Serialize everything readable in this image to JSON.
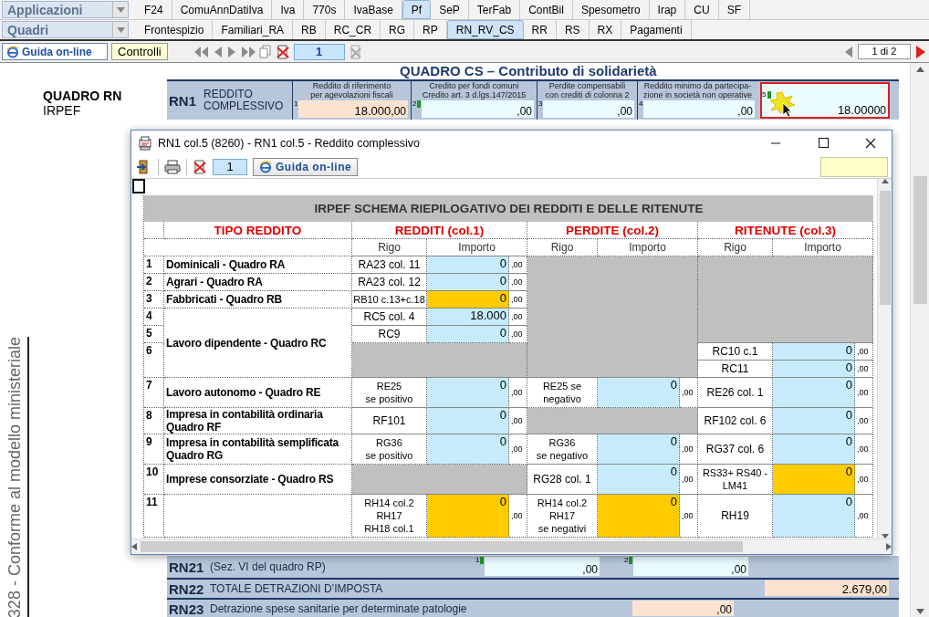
{
  "applicazioni": {
    "selector": "Applicazioni",
    "tabs": [
      {
        "label": "F24",
        "selected": false
      },
      {
        "label": "ComuAnnDatiIva",
        "selected": false
      },
      {
        "label": "Iva",
        "selected": false
      },
      {
        "label": "770s",
        "selected": false
      },
      {
        "label": "IvaBase",
        "selected": false
      },
      {
        "label": "Pf",
        "selected": true
      },
      {
        "label": "SeP",
        "selected": false
      },
      {
        "label": "TerFab",
        "selected": false
      },
      {
        "label": "ContBil",
        "selected": false
      },
      {
        "label": "Spesometro",
        "selected": false
      },
      {
        "label": "Irap",
        "selected": false
      },
      {
        "label": "CU",
        "selected": false
      },
      {
        "label": "SF",
        "selected": false
      }
    ]
  },
  "quadri": {
    "selector": "Quadri",
    "tabs": [
      {
        "label": "Frontespizio",
        "selected": false
      },
      {
        "label": "Familiari_RA",
        "selected": false
      },
      {
        "label": "RB",
        "selected": false
      },
      {
        "label": "RC_CR",
        "selected": false
      },
      {
        "label": "RG",
        "selected": false
      },
      {
        "label": "RP",
        "selected": false
      },
      {
        "label": "RN_RV_CS",
        "selected": true
      },
      {
        "label": "RR",
        "selected": false
      },
      {
        "label": "RS",
        "selected": false
      },
      {
        "label": "RX",
        "selected": false
      },
      {
        "label": "Pagamenti",
        "selected": false
      }
    ]
  },
  "toolbar": {
    "help_button": "Guida on-line",
    "controls_button": "Controlli",
    "page": "1",
    "page_indicator": "1 di 2"
  },
  "sidebar": {
    "title": "QUADRO RN",
    "subtitle": "IRPEF",
    "side_note": "328 - Conforme al modello ministeriale"
  },
  "form": {
    "header": "QUADRO CS – Contributo di solidarietà",
    "rn1": {
      "code": "RN1",
      "label": "REDDITO\nCOMPLESSIVO",
      "fields": [
        {
          "num": "1",
          "caption": "Reddito di riferimento\nper agevolazioni fiscali",
          "value": "18.000",
          "cents": ",00",
          "kind": "computed",
          "marked": false,
          "selected": false
        },
        {
          "num": "2",
          "caption": "Credito per fondi comuni\nCredito art. 3 d.lgs.147/2015",
          "cents": ",00",
          "kind": "input",
          "marked": true,
          "selected": false
        },
        {
          "num": "3",
          "caption": "Perdite compensabili\ncon crediti di colonna 2",
          "cents": ",00",
          "kind": "input",
          "marked": false,
          "selected": false
        },
        {
          "num": "4",
          "caption": "Reddito minimo da partecipa-\nzione in società non operative",
          "cents": ",00",
          "kind": "input",
          "marked": false,
          "selected": false
        },
        {
          "num": "5",
          "value": "18.000",
          "cents": "00",
          "kind": "input",
          "marked": true,
          "selected": true
        }
      ]
    },
    "rows": [
      {
        "code": "RN21",
        "label": "(Sez. VI del quadro RP)",
        "fields": [
          {
            "num": "1",
            "cents": ",00",
            "kind": "input",
            "marked": true
          },
          {
            "num": "2",
            "cents": ",00",
            "kind": "input",
            "marked": true
          }
        ]
      },
      {
        "code": "RN22",
        "label": "TOTALE DETRAZIONI D’IMPOSTA",
        "fields": [
          {
            "value": "2.679",
            "cents": ",00",
            "kind": "computed",
            "marked": false
          }
        ]
      },
      {
        "code": "RN23",
        "label": "Detrazione spese sanitarie per determinate patologie",
        "fields": [
          {
            "cents": ",00",
            "kind": "computed",
            "marked": false
          }
        ]
      }
    ]
  },
  "dialog": {
    "title": "RN1 col.5 (8260) - RN1 col.5 - Reddito complessivo",
    "page": "1",
    "help_button": "Guida on-line",
    "table": {
      "title": "IRPEF SCHEMA RIEPILOGATIVO DEI REDDITI E DELLE RITENUTE",
      "type_header": "TIPO REDDITO",
      "groups": [
        {
          "title": "REDDITI (col.1)",
          "rigo_header": "Rigo",
          "amount_header": "Importo"
        },
        {
          "title": "PERDITE (col.2)",
          "rigo_header": "Rigo",
          "amount_header": "Importo"
        },
        {
          "title": "RITENUTE (col.3)",
          "rigo_header": "Rigo",
          "amount_header": "Importo"
        }
      ],
      "rows": [
        {
          "num": "1",
          "label": "Dominicali - Quadro RA",
          "redditi": [
            {
              "rigo": "RA23 col. 11",
              "amount": "0",
              "cents": ",00",
              "highlighted": false
            }
          ]
        },
        {
          "num": "2",
          "label": "Agrari - Quadro RA",
          "redditi": [
            {
              "rigo": "RA23 col. 12",
              "amount": "0",
              "cents": ",00",
              "highlighted": false
            }
          ]
        },
        {
          "num": "3",
          "label": "Fabbricati - Quadro RB",
          "redditi": [
            {
              "rigo": "RB10 c.13+c.18",
              "amount": "0",
              "cents": ",00",
              "highlighted": true
            }
          ]
        },
        {
          "num": "4",
          "label": "Lavoro dipendente - Quadro RC",
          "redditi": [
            {
              "rigo": "RC5 col. 4",
              "amount": "18.000",
              "cents": ",00",
              "highlighted": false
            }
          ]
        },
        {
          "num": "5",
          "continues_above": true,
          "redditi": [
            {
              "rigo": "RC9",
              "amount": "0",
              "cents": ",00",
              "highlighted": false
            }
          ]
        },
        {
          "num": "6",
          "continues_above": true,
          "ritenute": [
            {
              "rigo": "RC10 c.1",
              "amount": "0",
              "cents": ",00",
              "highlighted": false
            },
            {
              "rigo": "RC11",
              "amount": "0",
              "cents": ",00",
              "highlighted": false
            }
          ]
        },
        {
          "num": "7",
          "label": "Lavoro autonomo - Quadro RE",
          "redditi": [
            {
              "rigo": "RE25\nse positivo",
              "amount": "0",
              "cents": ",00",
              "highlighted": false
            }
          ],
          "perdite": [
            {
              "rigo": "RE25 se\nnegativo",
              "amount": "0",
              "cents": ",00",
              "highlighted": false
            }
          ],
          "ritenute": [
            {
              "rigo": "RE26 col. 1",
              "amount": "0",
              "cents": ",00",
              "highlighted": false
            }
          ]
        },
        {
          "num": "8",
          "label": "Impresa in contabilità ordinaria\nQuadro RF",
          "redditi": [
            {
              "rigo": "RF101",
              "amount": "0",
              "cents": ",00",
              "highlighted": false
            }
          ],
          "ritenute": [
            {
              "rigo": "RF102 col. 6",
              "amount": "0",
              "cents": ",00",
              "highlighted": false
            }
          ]
        },
        {
          "num": "9",
          "label": "Impresa in contabilità semplificata\nQuadro RG",
          "redditi": [
            {
              "rigo": "RG36\nse positivo",
              "amount": "0",
              "cents": ",00",
              "highlighted": false
            }
          ],
          "perdite": [
            {
              "rigo": "RG36\nse negativo",
              "amount": "0",
              "cents": ",00",
              "highlighted": false
            }
          ],
          "ritenute": [
            {
              "rigo": "RG37 col. 6",
              "amount": "0",
              "cents": ",00",
              "highlighted": false
            }
          ]
        },
        {
          "num": "10",
          "label": "Imprese consorziate - Quadro RS",
          "perdite": [
            {
              "rigo": "RG28 col. 1",
              "amount": "0",
              "cents": ",00",
              "highlighted": false
            }
          ],
          "ritenute": [
            {
              "rigo": "RS33+ RS40 -\nLM41",
              "amount": "0",
              "cents": ",00",
              "highlighted": true
            }
          ]
        },
        {
          "num": "11",
          "redditi": [
            {
              "rigo": "RH14 col.2\nRH17\nRH18 col.1",
              "amount": "0",
              "cents": ",00",
              "highlighted": true
            }
          ],
          "perdite": [
            {
              "rigo": "RH14 col.2\nRH17\nse negativi",
              "amount": "0",
              "cents": ",00",
              "highlighted": true
            }
          ],
          "ritenute": [
            {
              "rigo": "RH19",
              "amount": "0",
              "cents": ",00",
              "highlighted": false
            }
          ]
        }
      ]
    }
  }
}
